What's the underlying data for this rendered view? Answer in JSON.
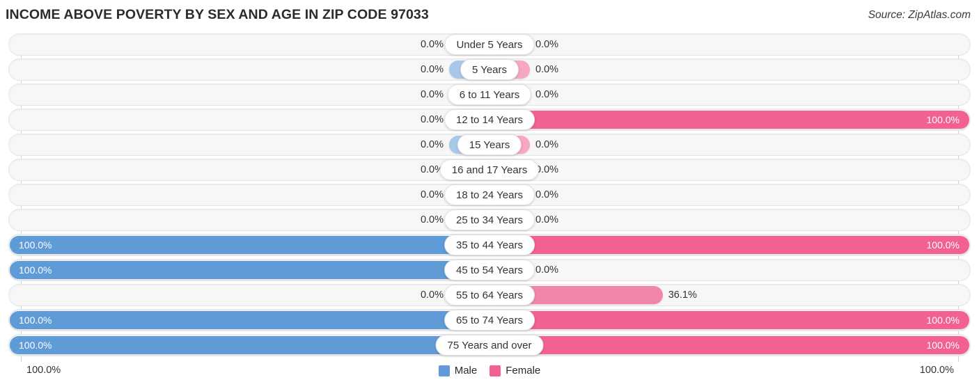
{
  "header": {
    "title": "INCOME ABOVE POVERTY BY SEX AND AGE IN ZIP CODE 97033",
    "source": "Source: ZipAtlas.com"
  },
  "axis": {
    "left_label": "100.0%",
    "right_label": "100.0%"
  },
  "legend": {
    "male_label": "Male",
    "female_label": "Female",
    "male_color": "#5e9bd7",
    "female_color": "#f2618f"
  },
  "colors": {
    "male_full": "#5e9bd7",
    "male_zero": "#a8c8ea",
    "female_full": "#f2618f",
    "female_part": "#f285ac",
    "female_zero": "#f7a6c3",
    "track": "#f7f7f7"
  },
  "chart_data": {
    "type": "bar",
    "title": "INCOME ABOVE POVERTY BY SEX AND AGE IN ZIP CODE 97033",
    "subtitle": "Source: ZipAtlas.com",
    "orientation": "horizontal-diverging",
    "xlabel": "",
    "ylabel": "",
    "xlim": [
      0,
      100
    ],
    "grid": false,
    "legend_position": "bottom-center",
    "axis_tick_labels": [
      "100.0%",
      "100.0%"
    ],
    "categories": [
      "Under 5 Years",
      "5 Years",
      "6 to 11 Years",
      "12 to 14 Years",
      "15 Years",
      "16 and 17 Years",
      "18 to 24 Years",
      "25 to 34 Years",
      "35 to 44 Years",
      "45 to 54 Years",
      "55 to 64 Years",
      "65 to 74 Years",
      "75 Years and over"
    ],
    "series": [
      {
        "name": "Male",
        "values": [
          0.0,
          0.0,
          0.0,
          0.0,
          0.0,
          0.0,
          0.0,
          0.0,
          100.0,
          100.0,
          0.0,
          100.0,
          100.0
        ],
        "labels": [
          "0.0%",
          "0.0%",
          "0.0%",
          "0.0%",
          "0.0%",
          "0.0%",
          "0.0%",
          "0.0%",
          "100.0%",
          "100.0%",
          "0.0%",
          "100.0%",
          "100.0%"
        ]
      },
      {
        "name": "Female",
        "values": [
          0.0,
          0.0,
          0.0,
          100.0,
          0.0,
          0.0,
          0.0,
          0.0,
          100.0,
          0.0,
          36.1,
          100.0,
          100.0
        ],
        "labels": [
          "0.0%",
          "0.0%",
          "0.0%",
          "100.0%",
          "0.0%",
          "0.0%",
          "0.0%",
          "0.0%",
          "100.0%",
          "0.0%",
          "36.1%",
          "100.0%",
          "100.0%"
        ]
      }
    ]
  }
}
